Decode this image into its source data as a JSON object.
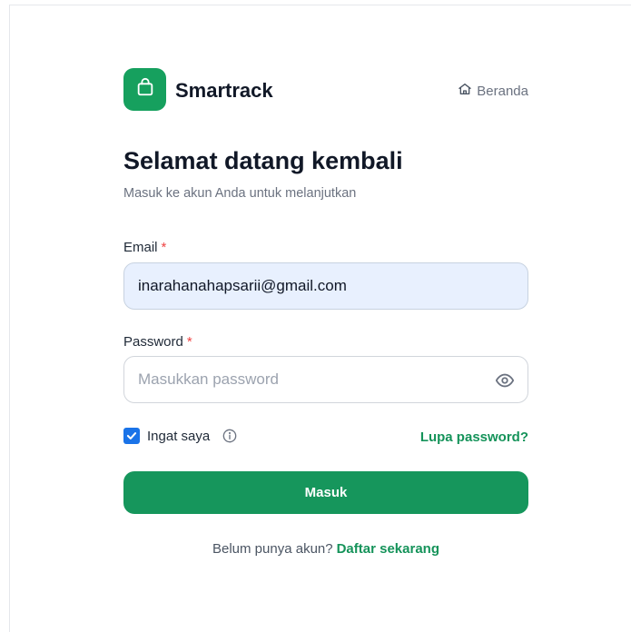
{
  "brand": {
    "name": "Smartrack",
    "logo_icon": "shopping-bag-icon",
    "accent_color": "#16a05e"
  },
  "nav": {
    "home_label": "Beranda",
    "home_icon": "home-icon"
  },
  "heading": {
    "title": "Selamat datang kembali",
    "subtitle": "Masuk ke akun Anda untuk melanjutkan"
  },
  "form": {
    "email_label": "Email",
    "email_value": "inarahanahapsarii@gmail.com",
    "required_mark": "*",
    "password_label": "Password",
    "password_placeholder": "Masukkan password",
    "password_toggle_icon": "eye-icon",
    "remember_label": "Ingat saya",
    "remember_checked": true,
    "info_icon": "info-icon",
    "forgot_label": "Lupa password?",
    "submit_label": "Masuk"
  },
  "signup": {
    "prompt": "Belum punya akun?",
    "link_label": "Daftar sekarang"
  }
}
